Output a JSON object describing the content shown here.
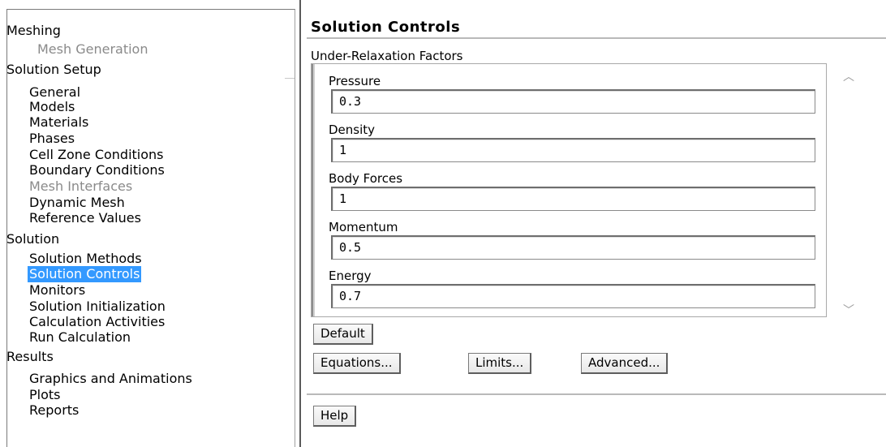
{
  "tree": {
    "items": [
      {
        "label": "Meshing"
      },
      {
        "label": "Mesh Generation"
      },
      {
        "label": "Solution Setup"
      },
      {
        "label": "General"
      },
      {
        "label": "Models"
      },
      {
        "label": "Materials"
      },
      {
        "label": "Phases"
      },
      {
        "label": "Cell Zone Conditions"
      },
      {
        "label": "Boundary Conditions"
      },
      {
        "label": "Mesh Interfaces"
      },
      {
        "label": "Dynamic Mesh"
      },
      {
        "label": "Reference Values"
      },
      {
        "label": "Solution"
      },
      {
        "label": "Solution Methods"
      },
      {
        "label": "Solution Controls"
      },
      {
        "label": "Monitors"
      },
      {
        "label": "Solution Initialization"
      },
      {
        "label": "Calculation Activities"
      },
      {
        "label": "Run Calculation"
      },
      {
        "label": "Results"
      },
      {
        "label": "Graphics and Animations"
      },
      {
        "label": "Plots"
      },
      {
        "label": "Reports"
      }
    ],
    "selected": "Solution Controls"
  },
  "panel": {
    "title": "Solution Controls",
    "group_label": "Under-Relaxation Factors",
    "fields": [
      {
        "label": "Pressure",
        "value": "0.3"
      },
      {
        "label": "Density",
        "value": "1"
      },
      {
        "label": "Body Forces",
        "value": "1"
      },
      {
        "label": "Momentum",
        "value": "0.5"
      },
      {
        "label": "Energy",
        "value": "0.7"
      }
    ],
    "buttons": {
      "default": "Default",
      "equations": "Equations...",
      "limits": "Limits...",
      "advanced": "Advanced...",
      "help": "Help"
    }
  },
  "colors": {
    "selection": "#3399ff",
    "disabled_text": "#8a8a8a"
  }
}
